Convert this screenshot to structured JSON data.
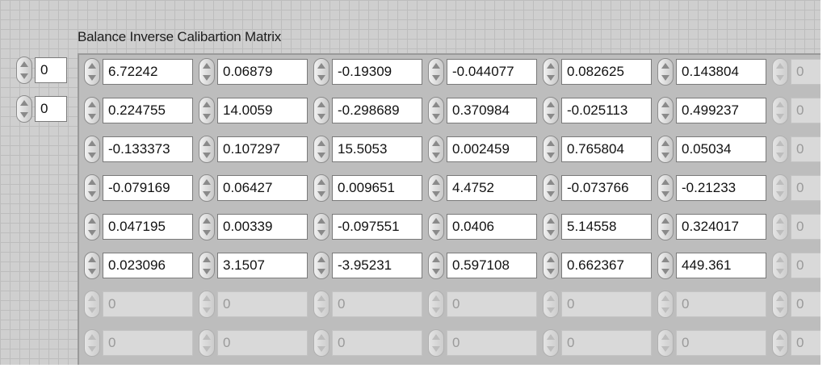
{
  "title": "Balance Inverse Calibartion Matrix",
  "indices": [
    "0",
    "0"
  ],
  "matrix": [
    [
      "6.72242",
      "0.06879",
      "-0.19309",
      "-0.044077",
      "0.082625",
      "0.143804",
      "0"
    ],
    [
      "0.224755",
      "14.0059",
      "-0.298689",
      "0.370984",
      "-0.025113",
      "0.499237",
      "0"
    ],
    [
      "-0.133373",
      "0.107297",
      "15.5053",
      "0.002459",
      "0.765804",
      "0.05034",
      "0"
    ],
    [
      "-0.079169",
      "0.06427",
      "0.009651",
      "4.4752",
      "-0.073766",
      "-0.21233",
      "0"
    ],
    [
      "0.047195",
      "0.00339",
      "-0.097551",
      "0.0406",
      "5.14558",
      "0.324017",
      "0"
    ],
    [
      "0.023096",
      "3.1507",
      "-3.95231",
      "0.597108",
      "0.662367",
      "449.361",
      "0"
    ],
    [
      "0",
      "0",
      "0",
      "0",
      "0",
      "0",
      "0"
    ],
    [
      "0",
      "0",
      "0",
      "0",
      "0",
      "0",
      "0"
    ]
  ],
  "active_rows": 6,
  "active_cols": 6
}
